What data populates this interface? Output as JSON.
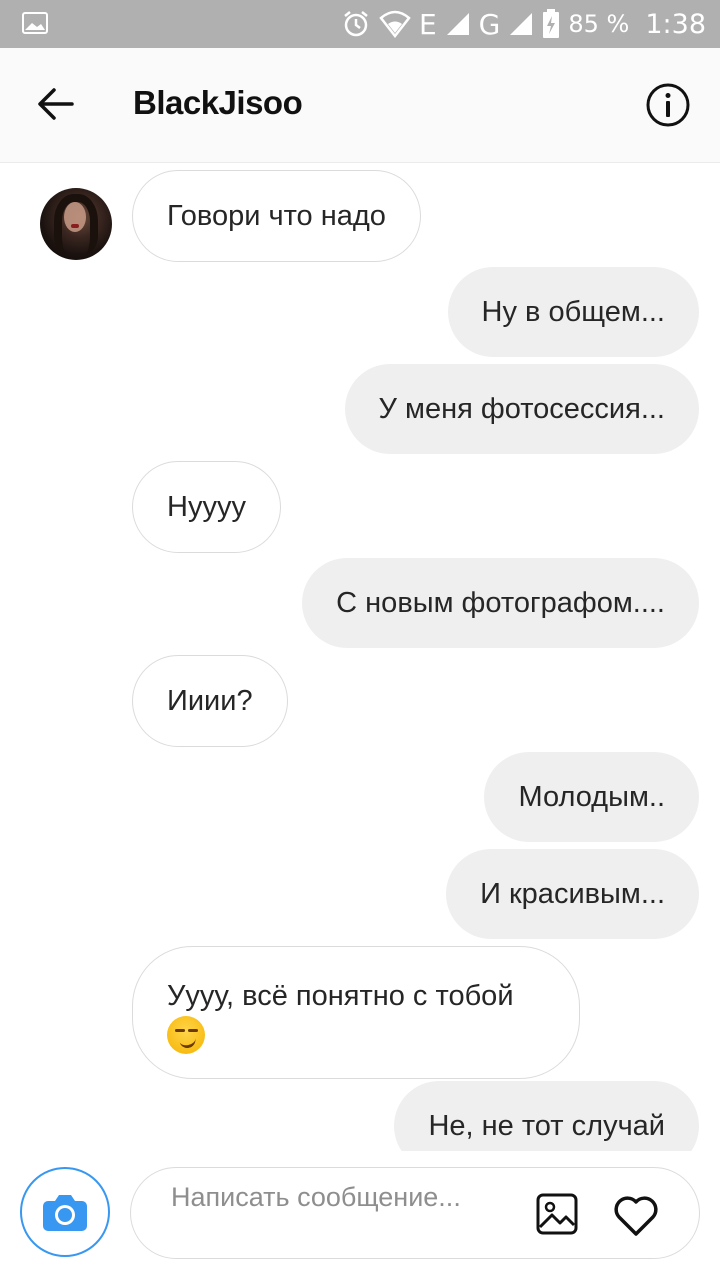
{
  "status_bar": {
    "battery": "85 %",
    "time": "1:38",
    "net_e": "E",
    "net_g": "G",
    "icons": [
      "image-icon",
      "alarm-icon",
      "wifi-icon",
      "signal-icon",
      "battery-icon"
    ]
  },
  "header": {
    "title": "BlackJisoo",
    "back_icon": "back-arrow-icon",
    "info_icon": "info-icon"
  },
  "messages": [
    {
      "side": "in",
      "text": "Говори что надо"
    },
    {
      "side": "out",
      "text": "Ну в общем..."
    },
    {
      "side": "out",
      "text": "У меня фотосессия..."
    },
    {
      "side": "in",
      "text": "Нуууу"
    },
    {
      "side": "out",
      "text": "С новым фотографом...."
    },
    {
      "side": "in",
      "text": "Ииии?"
    },
    {
      "side": "out",
      "text": "Молодым.."
    },
    {
      "side": "out",
      "text": "И красивым..."
    },
    {
      "side": "in",
      "text": "Уууу, всё понятно с тобой",
      "emoji": "smirk-emoji"
    },
    {
      "side": "out",
      "text": "Не, не тот случай"
    }
  ],
  "composer": {
    "placeholder": "Написать сообщение...",
    "camera_icon": "camera-icon",
    "gallery_icon": "gallery-icon",
    "heart_icon": "heart-icon"
  },
  "colors": {
    "accent": "#3897f0",
    "outgoing_bubble": "#efefef",
    "incoming_border": "#dbdbdb",
    "status_bar": "#b0b0b0"
  }
}
